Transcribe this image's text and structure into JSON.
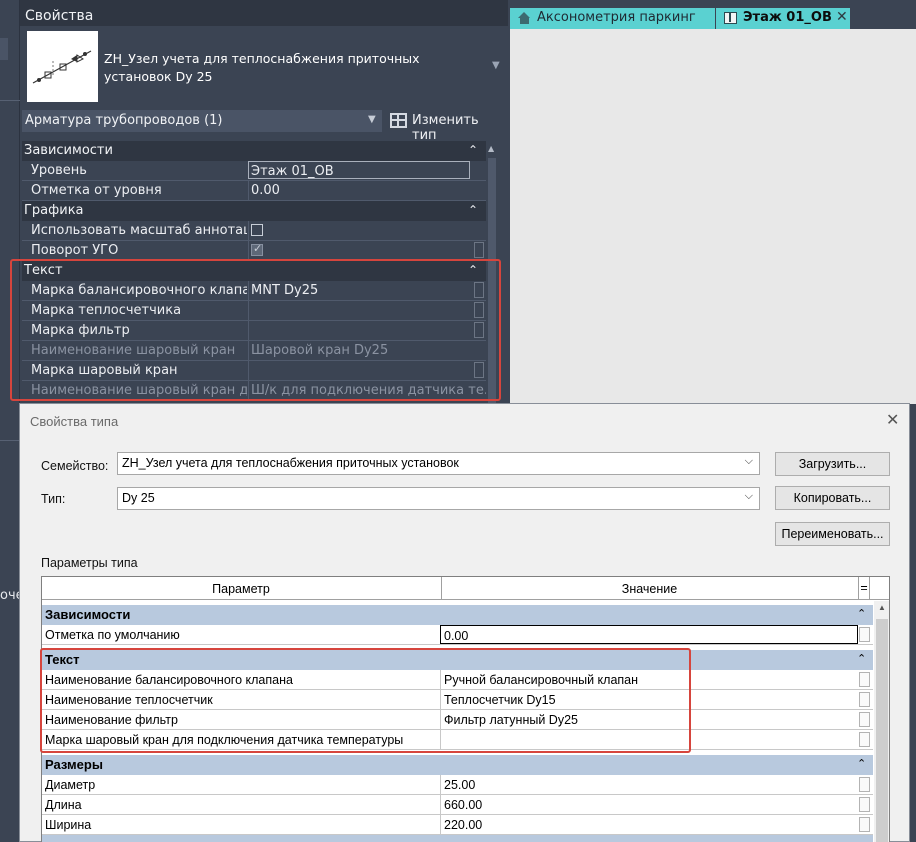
{
  "left_panel": {
    "cut_text": "очен"
  },
  "properties": {
    "title": "Свойства",
    "family_name": "ZH_Узел учета для теплоснабжения приточных установок Dy 25",
    "selector": "Арматура трубопроводов (1)",
    "edit_type": "Изменить тип",
    "categories": [
      {
        "name": "Зависимости",
        "collapse_glyph": "⌃"
      },
      {
        "name": "Графика",
        "collapse_glyph": "⌃"
      },
      {
        "name": "Текст",
        "collapse_glyph": "⌃"
      }
    ],
    "rows": {
      "level": {
        "name": "Уровень",
        "value": "Этаж 01_ОВ"
      },
      "offset": {
        "name": "Отметка от уровня",
        "value": "0.00"
      },
      "annot_scale": {
        "name": "Использовать масштаб аннотаций",
        "checked": false
      },
      "ugo_rotate": {
        "name": "Поворот УГО",
        "checked": true
      },
      "mark_balance": {
        "name": "Марка балансировочного клапана",
        "value": "MNT Dy25"
      },
      "mark_heatmeter": {
        "name": "Марка теплосчетчика",
        "value": ""
      },
      "mark_filter": {
        "name": "Марка фильтр",
        "value": ""
      },
      "name_ballvalve": {
        "name": "Наименование шаровый кран",
        "value": "Шаровой кран Dy25"
      },
      "mark_ballvalve": {
        "name": "Марка шаровый кран",
        "value": ""
      },
      "name_ballvalve_sensor": {
        "name": "Наименование шаровый кран д...",
        "value": "Ш/к для подключения датчика те..."
      }
    }
  },
  "view_tabs": [
    {
      "label": "Аксонометрия паркинг",
      "icon": "home-icon"
    },
    {
      "label": "Этаж 01_ОВ",
      "icon": "floor-plan-icon",
      "close": "✕"
    }
  ],
  "dialog": {
    "title": "Свойства типа",
    "close": "✕",
    "family_label": "Семейство:",
    "family_value": "ZH_Узел учета для теплоснабжения приточных установок",
    "type_label": "Тип:",
    "type_value": "Dy 25",
    "load_button": "Загрузить...",
    "copy_button": "Копировать...",
    "rename_button": "Переименовать...",
    "params_label": "Параметры типа",
    "table": {
      "col_param": "Параметр",
      "col_value": "Значение",
      "col_eq": "=",
      "sections": [
        {
          "name": "Зависимости",
          "rows": [
            {
              "name": "Отметка по умолчанию",
              "value": "0.00"
            }
          ]
        },
        {
          "name": "Текст",
          "rows": [
            {
              "name": "Наименование балансировочного клапана",
              "value": "Ручной балансировочный клапан"
            },
            {
              "name": "Наименование теплосчетчик",
              "value": "Теплосчетчик Dy15"
            },
            {
              "name": "Наименование фильтр",
              "value": "Фильтр латунный Dy25"
            },
            {
              "name": "Марка шаровый кран для подключения датчика температуры",
              "value": ""
            }
          ]
        },
        {
          "name": "Размеры",
          "rows": [
            {
              "name": "Диаметр",
              "value": "25.00"
            },
            {
              "name": "Длина",
              "value": "660.00"
            },
            {
              "name": "Ширина",
              "value": "220.00"
            }
          ]
        }
      ]
    }
  },
  "colors": {
    "dark_panel": "#3b4453",
    "category_dark": "#2f3642",
    "tab_cyan": "#5ad1d1",
    "dialog_category": "#b8c9de",
    "highlight_red": "#d6453d"
  }
}
